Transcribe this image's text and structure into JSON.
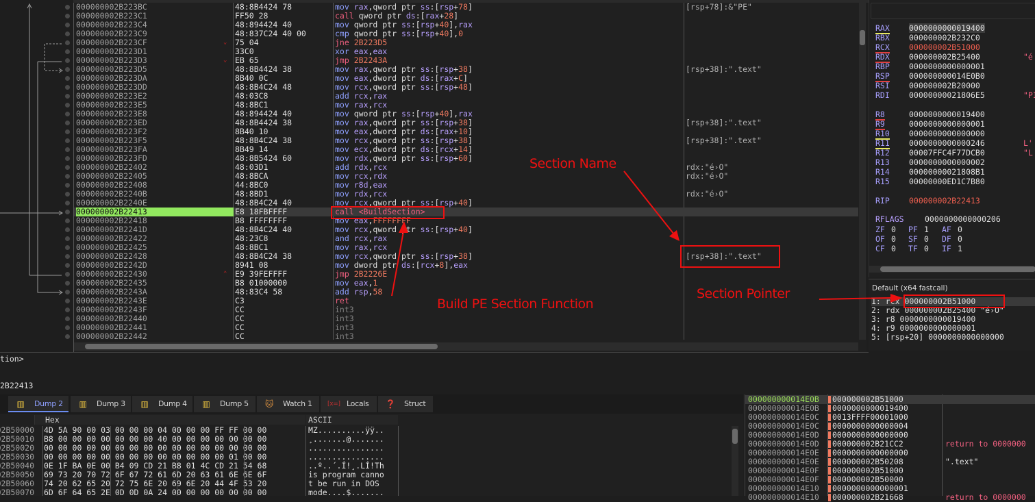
{
  "disasm": {
    "rows": [
      {
        "addr": "000000002B223BC",
        "bytes": "48:8B4424 78",
        "ins": "mov rax,qword ptr ss:[rsp+78]",
        "cmt": "[rsp+78]:&\"PE\""
      },
      {
        "addr": "000000002B223C1",
        "bytes": "FF50 28",
        "ins": "call qword ptr ds:[rax+28]",
        "cmt": ""
      },
      {
        "addr": "000000002B223C4",
        "bytes": "48:894424 40",
        "ins": "mov qword ptr ss:[rsp+40],rax",
        "cmt": ""
      },
      {
        "addr": "000000002B223C9",
        "bytes": "48:837C24 40 00",
        "ins": "cmp qword ptr ss:[rsp+40],0",
        "cmt": ""
      },
      {
        "addr": "000000002B223CF",
        "bytes": "75 04",
        "ins": "jne 2B223D5",
        "cmt": "",
        "jump": "v"
      },
      {
        "addr": "000000002B223D1",
        "bytes": "33C0",
        "ins": "xor eax,eax",
        "cmt": ""
      },
      {
        "addr": "000000002B223D3",
        "bytes": "EB 65",
        "ins": "jmp 2B2243A",
        "cmt": "",
        "jump": "v"
      },
      {
        "addr": "000000002B223D5",
        "bytes": "48:8B4424 38",
        "ins": "mov rax,qword ptr ss:[rsp+38]",
        "cmt": "[rsp+38]:\".text\""
      },
      {
        "addr": "000000002B223DA",
        "bytes": "8B40 0C",
        "ins": "mov eax,dword ptr ds:[rax+C]",
        "cmt": ""
      },
      {
        "addr": "000000002B223DD",
        "bytes": "48:8B4C24 48",
        "ins": "mov rcx,qword ptr ss:[rsp+48]",
        "cmt": ""
      },
      {
        "addr": "000000002B223E2",
        "bytes": "48:03C8",
        "ins": "add rcx,rax",
        "cmt": ""
      },
      {
        "addr": "000000002B223E5",
        "bytes": "48:8BC1",
        "ins": "mov rax,rcx",
        "cmt": ""
      },
      {
        "addr": "000000002B223E8",
        "bytes": "48:894424 40",
        "ins": "mov qword ptr ss:[rsp+40],rax",
        "cmt": ""
      },
      {
        "addr": "000000002B223ED",
        "bytes": "48:8B4424 38",
        "ins": "mov rax,qword ptr ss:[rsp+38]",
        "cmt": "[rsp+38]:\".text\""
      },
      {
        "addr": "000000002B223F2",
        "bytes": "8B40 10",
        "ins": "mov eax,dword ptr ds:[rax+10]",
        "cmt": ""
      },
      {
        "addr": "000000002B223F5",
        "bytes": "48:8B4C24 38",
        "ins": "mov rcx,qword ptr ss:[rsp+38]",
        "cmt": "[rsp+38]:\".text\""
      },
      {
        "addr": "000000002B223FA",
        "bytes": "8B49 14",
        "ins": "mov ecx,dword ptr ds:[rcx+14]",
        "cmt": ""
      },
      {
        "addr": "000000002B223FD",
        "bytes": "48:8B5424 60",
        "ins": "mov rdx,qword ptr ss:[rsp+60]",
        "cmt": ""
      },
      {
        "addr": "000000002B22402",
        "bytes": "48:03D1",
        "ins": "add rdx,rcx",
        "cmt": "rdx:\"é›O\""
      },
      {
        "addr": "000000002B22405",
        "bytes": "48:8BCA",
        "ins": "mov rcx,rdx",
        "cmt": "rdx:\"é›O\""
      },
      {
        "addr": "000000002B22408",
        "bytes": "44:8BC0",
        "ins": "mov r8d,eax",
        "cmt": ""
      },
      {
        "addr": "000000002B2240B",
        "bytes": "48:8BD1",
        "ins": "mov rdx,rcx",
        "cmt": "rdx:\"é›O\""
      },
      {
        "addr": "000000002B2240E",
        "bytes": "48:8B4C24 40",
        "ins": "mov rcx,qword ptr ss:[rsp+40]",
        "cmt": ""
      },
      {
        "addr": "000000002B22413",
        "bytes": "E8 18FBFFFF",
        "ins": "call <BuildSection>",
        "cmt": "",
        "current": true
      },
      {
        "addr": "000000002B22418",
        "bytes": "B8 FFFFFFFF",
        "ins": "mov eax,FFFFFFFF",
        "cmt": ""
      },
      {
        "addr": "000000002B2241D",
        "bytes": "48:8B4C24 40",
        "ins": "mov rcx,qword ptr ss:[rsp+40]",
        "cmt": ""
      },
      {
        "addr": "000000002B22422",
        "bytes": "48:23C8",
        "ins": "and rcx,rax",
        "cmt": ""
      },
      {
        "addr": "000000002B22425",
        "bytes": "48:8BC1",
        "ins": "mov rax,rcx",
        "cmt": ""
      },
      {
        "addr": "000000002B22428",
        "bytes": "48:8B4C24 38",
        "ins": "mov rcx,qword ptr ss:[rsp+38]",
        "cmt": "[rsp+38]:\".text\""
      },
      {
        "addr": "000000002B2242D",
        "bytes": "8941 08",
        "ins": "mov dword ptr ds:[rcx+8],eax",
        "cmt": ""
      },
      {
        "addr": "000000002B22430",
        "bytes": "E9 39FEFFFF",
        "ins": "jmp 2B2226E",
        "cmt": "",
        "jump": "^"
      },
      {
        "addr": "000000002B22435",
        "bytes": "B8 01000000",
        "ins": "mov eax,1",
        "cmt": ""
      },
      {
        "addr": "000000002B2243A",
        "bytes": "48:83C4 58",
        "ins": "add rsp,58",
        "cmt": ""
      },
      {
        "addr": "000000002B2243E",
        "bytes": "C3",
        "ins": "ret",
        "cmt": ""
      },
      {
        "addr": "000000002B2243F",
        "bytes": "CC",
        "ins": "int3",
        "cmt": ""
      },
      {
        "addr": "000000002B22440",
        "bytes": "CC",
        "ins": "int3",
        "cmt": ""
      },
      {
        "addr": "000000002B22441",
        "bytes": "CC",
        "ins": "int3",
        "cmt": ""
      },
      {
        "addr": "000000002B22442",
        "bytes": "CC",
        "ins": "int3",
        "cmt": ""
      }
    ]
  },
  "registers": {
    "rows": [
      {
        "name": "RAX",
        "value": "0000000000019400",
        "mark": "y",
        "hl": true
      },
      {
        "name": "RBX",
        "value": "000000002B232C0"
      },
      {
        "name": "RCX",
        "value": "000000002B51000",
        "mark": "r",
        "changed": true
      },
      {
        "name": "RDX",
        "value": "000000002B25400",
        "mark": "r",
        "cmt": "\"é"
      },
      {
        "name": "RBP",
        "value": "0000000000000001"
      },
      {
        "name": "RSP",
        "value": "000000000014E0B0",
        "mark": "r"
      },
      {
        "name": "RSI",
        "value": "000000002B20000"
      },
      {
        "name": "RDI",
        "value": "00000000021806E5",
        "cmt": "\"PI"
      },
      {
        "gap": true
      },
      {
        "name": "R8",
        "value": "0000000000019400",
        "mark": "r"
      },
      {
        "name": "R9",
        "value": "0000000000000001",
        "mark": "r"
      },
      {
        "name": "R10",
        "value": "0000000000000000",
        "mark": "y"
      },
      {
        "name": "R11",
        "value": "0000000000000246",
        "mark": "y",
        "cmt": "L'"
      },
      {
        "name": "R12",
        "value": "00007FFC4F77DCB0",
        "cmt": "\"L"
      },
      {
        "name": "R13",
        "value": "0000000000000002"
      },
      {
        "name": "R14",
        "value": "00000000021808B1"
      },
      {
        "name": "R15",
        "value": "00000000ED1C7B80"
      },
      {
        "gap": true
      },
      {
        "name": "RIP",
        "value": "000000002B22413",
        "changed": true
      }
    ],
    "rflags_label": "RFLAGS",
    "rflags": "0000000000000206",
    "flags": [
      [
        "ZF",
        "0",
        "PF",
        "1",
        "AF",
        "0"
      ],
      [
        "OF",
        "0",
        "SF",
        "0",
        "DF",
        "0"
      ],
      [
        "CF",
        "0",
        "TF",
        "0",
        "IF",
        "1"
      ]
    ]
  },
  "callargs": {
    "title": "Default (x64 fastcall)",
    "lines": [
      "1: rcx 000000002B51000",
      "2: rdx 000000002B25400 \"é›O\"",
      "3: r8 0000000000019400",
      "4: r9 0000000000000001",
      "5: [rsp+20] 0000000000000000"
    ]
  },
  "command": {
    "line1": "tion>",
    "line2": "2B22413"
  },
  "tabs": [
    {
      "label": "Dump 2",
      "icon": "dump-icon",
      "active": true
    },
    {
      "label": "Dump 3",
      "icon": "dump-icon"
    },
    {
      "label": "Dump 4",
      "icon": "dump-icon"
    },
    {
      "label": "Dump 5",
      "icon": "dump-icon"
    },
    {
      "label": "Watch 1",
      "icon": "watch-icon"
    },
    {
      "label": "Locals",
      "icon": "locals-icon"
    },
    {
      "label": "Struct",
      "icon": "struct-icon"
    }
  ],
  "dump": {
    "hex_header": "Hex",
    "ascii_header": "ASCII",
    "rows": [
      {
        "addr": "02B50000",
        "hex": "4D 5A 90 00|03 00 00 00|04 00 00 00|FF FF 00 00",
        "ascii": "MZ..........ÿÿ.."
      },
      {
        "addr": "02B50010",
        "hex": "B8 00 00 00|00 00 00 00|40 00 00 00|00 00 00 00",
        "ascii": "¸.......@......."
      },
      {
        "addr": "02B50020",
        "hex": "00 00 00 00|00 00 00 00|00 00 00 00|00 00 00 00",
        "ascii": "................"
      },
      {
        "addr": "02B50030",
        "hex": "00 00 00 00|00 00 00 00|00 00 00 00|00 01 00 00",
        "ascii": "................"
      },
      {
        "addr": "02B50040",
        "hex": "0E 1F BA 0E|00 B4 09 CD|21 B8 01 4C|CD 21 54 68",
        "ascii": "..º..´.Í!¸.LÍ!Th"
      },
      {
        "addr": "02B50050",
        "hex": "69 73 20 70|72 6F 67 72|61 6D 20 63|61 6E 6E 6F",
        "ascii": "is program canno"
      },
      {
        "addr": "02B50060",
        "hex": "74 20 62 65|20 72 75 6E|20 69 6E 20|44 4F 53 20",
        "ascii": "t be run in DOS "
      },
      {
        "addr": "02B50070",
        "hex": "6D 6F 64 65|2E 0D 0D 0A|24 00 00 00|00 00 00 00",
        "ascii": "mode....$......."
      }
    ]
  },
  "stack": {
    "rows": [
      {
        "addr": "000000000014E0B",
        "value": "000000002B51000",
        "cmt": ""
      },
      {
        "addr": "000000000014E0B",
        "value": "0000000000019400",
        "cmt": ""
      },
      {
        "addr": "000000000014E0C",
        "value": "0013FFFF00001000",
        "cmt": ""
      },
      {
        "addr": "000000000014E0C",
        "value": "0000000000000004",
        "cmt": ""
      },
      {
        "addr": "000000000014E0D",
        "value": "0000000000000000",
        "cmt": ""
      },
      {
        "addr": "000000000014E0D",
        "value": "000000002B21CC2",
        "cmt": "return to 0000000"
      },
      {
        "addr": "000000000014E0E",
        "value": "0000000000000000",
        "cmt": ""
      },
      {
        "addr": "000000000014E0E",
        "value": "000000002B50208",
        "cmt": "\".text\""
      },
      {
        "addr": "000000000014E0F",
        "value": "000000002B51000",
        "cmt": ""
      },
      {
        "addr": "000000000014E0F",
        "value": "000000002B50000",
        "cmt": ""
      },
      {
        "addr": "000000000014E10",
        "value": "0000000000000001",
        "cmt": ""
      },
      {
        "addr": "000000000014E10",
        "value": "000000002B21668",
        "cmt": "return to 0000000"
      }
    ]
  },
  "annotations": {
    "section_name": "Section Name",
    "build_fn": "Build PE Section Function",
    "section_pointer": "Section Pointer",
    "color": "#ee1111"
  }
}
